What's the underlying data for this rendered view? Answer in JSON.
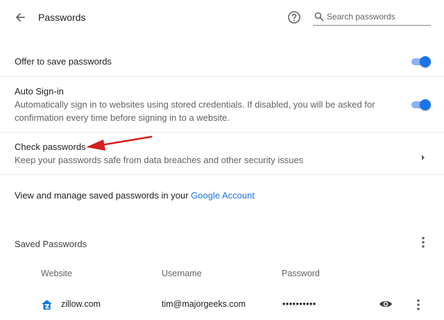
{
  "header": {
    "title": "Passwords",
    "search_placeholder": "Search passwords"
  },
  "offer_save": {
    "label": "Offer to save passwords",
    "enabled": true
  },
  "auto_signin": {
    "title": "Auto Sign-in",
    "description": "Automatically sign in to websites using stored credentials. If disabled, you will be asked for confirmation every time before signing in to a website.",
    "enabled": true
  },
  "check_passwords": {
    "title": "Check passwords",
    "description": "Keep your passwords safe from data breaches and other security issues"
  },
  "manage": {
    "text": "View and manage saved passwords in your ",
    "link": "Google Account"
  },
  "saved": {
    "heading": "Saved Passwords",
    "columns": [
      "Website",
      "Username",
      "Password"
    ],
    "rows": [
      {
        "website": "zillow.com",
        "username": "tim@majorgeeks.com",
        "password": "••••••••••"
      }
    ]
  },
  "colors": {
    "accent": "#1a73e8",
    "annotation_arrow": "#d42020"
  }
}
